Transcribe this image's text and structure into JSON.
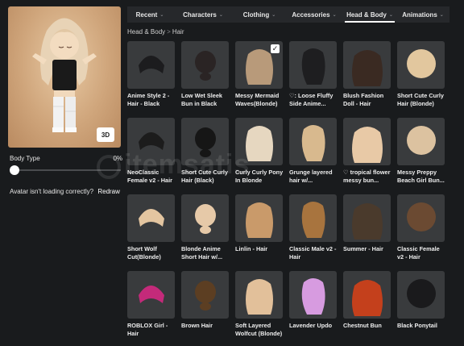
{
  "tabs": [
    {
      "label": "Recent",
      "has_chevron": true,
      "active": false
    },
    {
      "label": "Characters",
      "has_chevron": true,
      "active": false
    },
    {
      "label": "Clothing",
      "has_chevron": true,
      "active": false
    },
    {
      "label": "Accessories",
      "has_chevron": true,
      "active": false
    },
    {
      "label": "Head & Body",
      "has_chevron": true,
      "active": true
    },
    {
      "label": "Animations",
      "has_chevron": true,
      "active": false
    }
  ],
  "breadcrumb": {
    "parent": "Head & Body",
    "separator": ">",
    "current": "Hair"
  },
  "avatar_panel": {
    "view_button_label": "3D",
    "body_type_label": "Body Type",
    "body_type_value": "0%",
    "body_type_slider_fraction": 0.0,
    "loading_text": "Avatar isn't loading correctly?",
    "redraw_label": "Redraw"
  },
  "watermark": "itemsatis",
  "items": [
    {
      "name": "Anime Style 2 - Hair - Black",
      "hair_color": "#1c1c1e",
      "equipped": false
    },
    {
      "name": "Low Wet Sleek Bun in Black",
      "hair_color": "#2a2424",
      "equipped": false
    },
    {
      "name": "Messy Mermaid Waves(Blonde)",
      "hair_color": "#b89a7a",
      "equipped": true
    },
    {
      "name": "♡: Loose Fluffy Side Anime...",
      "hair_color": "#1e1e20",
      "equipped": false
    },
    {
      "name": "Blush Fashion Doll - Hair",
      "hair_color": "#3a2a22",
      "equipped": false
    },
    {
      "name": "Short Cute Curly Hair (Blonde)",
      "hair_color": "#e2c79e",
      "equipped": false
    },
    {
      "name": "NeoClassic Female v2 - Hair",
      "hair_color": "#1c1c1c",
      "equipped": false
    },
    {
      "name": "Short Cute Curly Hair (Black)",
      "hair_color": "#161616",
      "equipped": false
    },
    {
      "name": "Curly Curly Pony In Blonde",
      "hair_color": "#e6d7c0",
      "equipped": false
    },
    {
      "name": "Grunge layered hair w/...",
      "hair_color": "#d8b98e",
      "equipped": false
    },
    {
      "name": "♡ tropical flower messy bun...",
      "hair_color": "#e8c9a6",
      "equipped": false
    },
    {
      "name": "Messy Preppy Beach Girl Bun...",
      "hair_color": "#dcc2a0",
      "equipped": false
    },
    {
      "name": "Short Wolf Cut(Blonde)",
      "hair_color": "#e3c5a0",
      "equipped": false
    },
    {
      "name": "Blonde Anime Short Hair w/...",
      "hair_color": "#e6c9a8",
      "equipped": false
    },
    {
      "name": "Linlin - Hair",
      "hair_color": "#c99a6a",
      "equipped": false
    },
    {
      "name": "Classic Male v2 - Hair",
      "hair_color": "#a8743e",
      "equipped": false
    },
    {
      "name": "Summer - Hair",
      "hair_color": "#4a3a2c",
      "equipped": false
    },
    {
      "name": "Classic Female v2 - Hair",
      "hair_color": "#6b4a32",
      "equipped": false
    },
    {
      "name": "ROBLOX Girl - Hair",
      "hair_color": "#c42a7a",
      "equipped": false
    },
    {
      "name": "Brown Hair",
      "hair_color": "#5c3e22",
      "equipped": false
    },
    {
      "name": "Soft Layered Wolfcut (Blonde)",
      "hair_color": "#e2c09a",
      "equipped": false
    },
    {
      "name": "Lavender Updo",
      "hair_color": "#d79be0",
      "equipped": false
    },
    {
      "name": "Chestnut Bun",
      "hair_color": "#c4401c",
      "equipped": false
    },
    {
      "name": "Black Ponytail",
      "hair_color": "#1a1a1c",
      "equipped": false
    }
  ]
}
